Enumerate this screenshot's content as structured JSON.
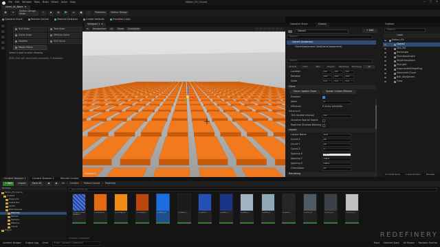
{
  "app": {
    "project_title": "Motion_FX_Course",
    "level_tab": "Level_01_Basic",
    "menus": [
      "File",
      "Edit",
      "Window",
      "Tools",
      "Build",
      "Select",
      "Actor",
      "Help"
    ],
    "window_buttons": [
      "—",
      "▢",
      "✕"
    ]
  },
  "toolbar": {
    "mode_label": "Motion Design Mode",
    "platforms_label": "Platforms",
    "motion_design_label": "Motion Design"
  },
  "quickbar": {
    "items": [
      "Operator Stack",
      "Remote Control",
      "Material Designer",
      "Create Defaults",
      "Transition Logic"
    ]
  },
  "tool_modes": {
    "buttons": [
      "Null Actor",
      "Clone Actor",
      "Effector Actor",
      "Modifier",
      "Text Actor",
      "Clone Actor",
      "SVG Actor",
      "Shape Actor",
      "Effector Actor",
      "Modifier",
      "Media Plane",
      "Blueprint Actor"
    ],
    "hint_title": "Select a tool to start drawing",
    "hint_body": "Shift-click will show best previews, if available."
  },
  "viewport": {
    "tab_label": "Viewport 1",
    "toolbar_items": [
      "Perspective",
      "Lit",
      "Show",
      "Scalability"
    ],
    "label": "Viewport1"
  },
  "details": {
    "tabs": [
      "Operator Stack",
      "Details"
    ],
    "add_label": "+ Add",
    "name_value": "Clone2",
    "components": [
      "Clone2 (Instance)",
      "CloneComponent (AvaCloneComponent)"
    ],
    "search_placeholder": "Search",
    "filter_tabs": [
      "General",
      "Actor",
      "Misc",
      "Physics",
      "Rendering",
      "Streaming",
      "All"
    ],
    "transform_rows": [
      {
        "label": "Location",
        "values": [
          "0.0",
          "0.0",
          "0.0"
        ]
      },
      {
        "label": "Rotation",
        "values": [
          "0.0°",
          "0.0°",
          "0.0°"
        ]
      },
      {
        "label": "Scale",
        "values": [
          "1.0",
          "1.0",
          "1.0"
        ]
      }
    ],
    "section_clone": "Clone",
    "buttons": [
      "Force Update Clone",
      "Spawn Linked Effector"
    ],
    "clone_rows": [
      {
        "label": "Enabled",
        "value": ""
      },
      {
        "label": "Seed",
        "value": "0"
      },
      {
        "label": "Effectors",
        "value": "0 Array elements"
      }
    ],
    "section_advanced": "Advanced",
    "advanced_rows": [
      {
        "label": "Tick Update Interval",
        "value": "0.0"
      },
      {
        "label": "Visualize Sparse Voxels",
        "value": ""
      },
      {
        "label": "Realtime Shadow Warning",
        "value": ""
      }
    ],
    "section_layout": "Layout",
    "layout_rows": [
      {
        "label": "Layout Name",
        "value": "Grid"
      },
      {
        "label": "Count X",
        "value": "20"
      },
      {
        "label": "Count Y",
        "value": "20"
      },
      {
        "label": "Count Z",
        "value": "1"
      },
      {
        "label": "Spacing X",
        "value": "100.0"
      },
      {
        "label": "Spacing Y",
        "value": "100.0"
      },
      {
        "label": "Spacing Z",
        "value": "100.0"
      },
      {
        "label": "Orientation",
        "value": "XY"
      }
    ],
    "section_rendering": "Rendering"
  },
  "outliner": {
    "tab_label": "Outliner",
    "search_placeholder": "Search",
    "label_header": "Label",
    "rows": [
      "Motion_FX",
      "Clone2",
      "Dev_BG",
      "Rectangle",
      "DirectionalLight",
      "SkyAtmosphere",
      "SkyLight",
      "ExponentialHeightFog",
      "VolumetricCloud",
      "Ball_SkySphere",
      "Floor"
    ],
    "footer": [
      "12 visible items",
      "1 selected item",
      "Previews"
    ]
  },
  "content_browser": {
    "tabs": [
      "Content Browser 1",
      "Content Browser 2",
      "Remote Control"
    ],
    "add_label": "+ Add",
    "import_label": "Import",
    "save_all_label": "Save All",
    "breadcrumb": [
      "All",
      "Content",
      "MotionCourse",
      "Materials"
    ],
    "search_placeholder": "Search Materials",
    "tree_title": "Favorites",
    "tree": [
      "Motion_FX_Course",
      "Content",
      "Blueprints",
      "Characters",
      "Levels",
      "MotionCourse",
      "Materials",
      "Meshes",
      "Textures",
      "Effectors",
      "Clones",
      "Engine"
    ],
    "assets": [
      {
        "name": "TransformMaterial Control 2",
        "color": "#2244aa",
        "pattern": true
      },
      {
        "name": "M_Orange_01",
        "color": "#e36a10"
      },
      {
        "name": "M_Orange_02",
        "color": "#f28a16"
      },
      {
        "name": "M_Orange_03",
        "color": "#b8470e"
      },
      {
        "name": "MI_Basic_01",
        "color": "#1d6de0",
        "selected": true
      },
      {
        "name": "MI_Basic_2",
        "color": "#1a1a1a"
      },
      {
        "name": "MI_Basic_3",
        "color": "#2550b8"
      },
      {
        "name": "MI_Basic_4",
        "color": "#1a3488"
      },
      {
        "name": "MI_Basic_5",
        "color": "#9fb3c0"
      },
      {
        "name": "MI_Basic_6",
        "color": "#8fa8b8"
      },
      {
        "name": "MI_Basic_7",
        "color": "#262626"
      },
      {
        "name": "MI_Grid_01",
        "color": "#505a62"
      },
      {
        "name": "MI_Grid_02",
        "color": "#3c4148"
      },
      {
        "name": "MI_White_01",
        "color": "#c0c0c0"
      }
    ],
    "count": "15 items (1 selected)"
  },
  "statusbar": {
    "items": [
      "Content Drawer",
      "Output Log",
      "Cmd"
    ],
    "cmd_placeholder": "Enter Console Command",
    "right_items": [
      "Trace",
      "Derived Data",
      "All Saved",
      "Revision Control"
    ]
  },
  "watermark": "REDEFINERY",
  "colors": {
    "tile_top": "#f17a1f",
    "tile_side": "#c85a0c",
    "gap": "#b6b6b6",
    "accent_blue": "#2d4d75"
  }
}
